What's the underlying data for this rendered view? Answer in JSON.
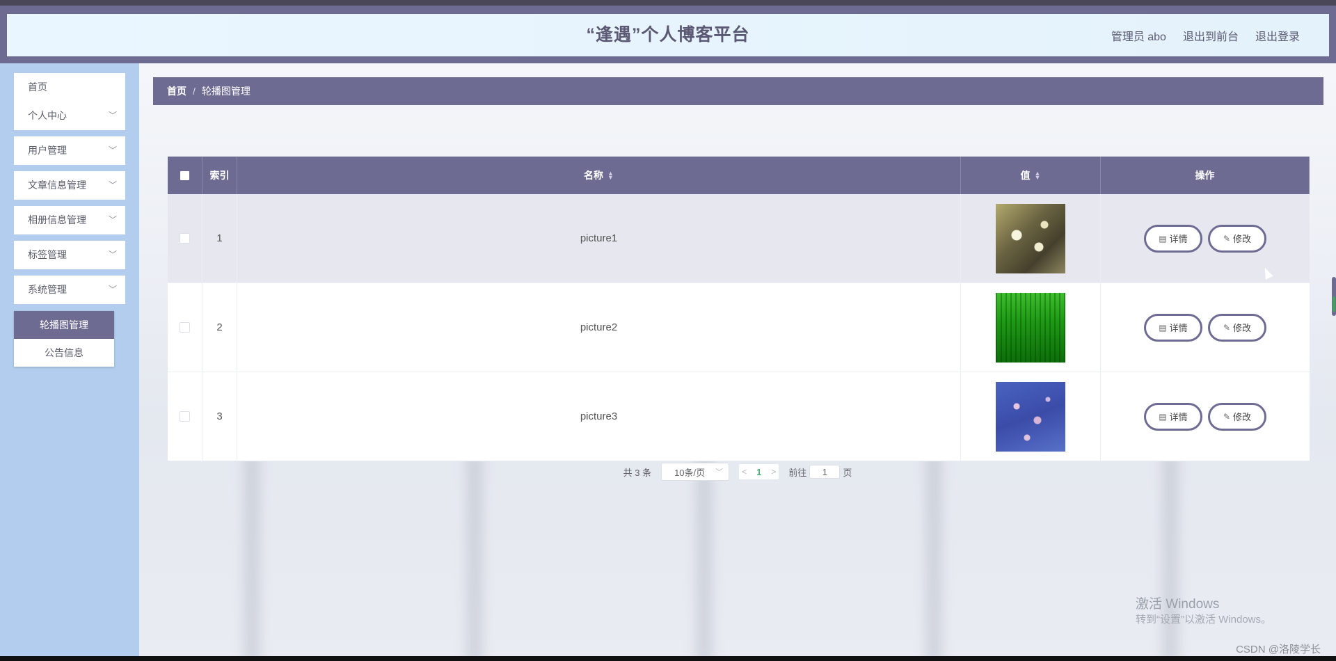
{
  "header": {
    "title": "“逢遇”个人博客平台",
    "user": "管理员 abo",
    "to_front": "退出到前台",
    "logout": "退出登录"
  },
  "sidebar": {
    "items": [
      {
        "label": "首页",
        "has_children": false
      },
      {
        "label": "个人中心",
        "has_children": true
      },
      {
        "label": "用户管理",
        "has_children": true
      },
      {
        "label": "文章信息管理",
        "has_children": true
      },
      {
        "label": "相册信息管理",
        "has_children": true
      },
      {
        "label": "标签管理",
        "has_children": true
      },
      {
        "label": "系统管理",
        "has_children": true
      }
    ],
    "submenu": [
      {
        "label": "轮播图管理",
        "active": true
      },
      {
        "label": "公告信息",
        "active": false
      }
    ]
  },
  "breadcrumb": {
    "home": "首页",
    "separator": "/",
    "current": "轮播图管理"
  },
  "table": {
    "columns": {
      "index": "索引",
      "name": "名称",
      "value": "值",
      "ops": "操作"
    },
    "rows": [
      {
        "index": "1",
        "name": "picture1",
        "image": "flowers-thumbnail",
        "hover": true
      },
      {
        "index": "2",
        "name": "picture2",
        "image": "grass-thumbnail",
        "hover": false
      },
      {
        "index": "3",
        "name": "picture3",
        "image": "blossom-thumbnail",
        "hover": false
      }
    ],
    "detail_label": "详情",
    "edit_label": "修改"
  },
  "pagination": {
    "total": "共 3 条",
    "page_size": "10条/页",
    "current_page": "1",
    "goto_label": "前往",
    "goto_value": "1",
    "page_suffix": "页"
  },
  "watermark": {
    "line1": "激活 Windows",
    "line2": "转到“设置”以激活 Windows。"
  },
  "csdn": "CSDN @洛陵学长",
  "colors": {
    "accent": "#6e6b93",
    "sidebar_bg": "#b2cdee",
    "header_bg": "#eaf6ff",
    "page_active": "#4caf7a"
  }
}
